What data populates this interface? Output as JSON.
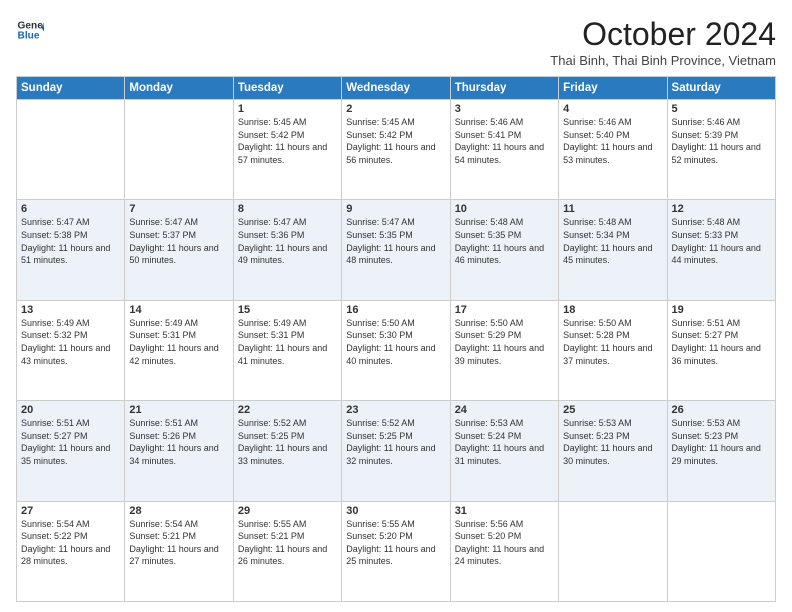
{
  "header": {
    "logo_line1": "General",
    "logo_line2": "Blue",
    "month_title": "October 2024",
    "location": "Thai Binh, Thai Binh Province, Vietnam"
  },
  "days_of_week": [
    "Sunday",
    "Monday",
    "Tuesday",
    "Wednesday",
    "Thursday",
    "Friday",
    "Saturday"
  ],
  "weeks": [
    [
      {
        "day": "",
        "info": ""
      },
      {
        "day": "",
        "info": ""
      },
      {
        "day": "1",
        "info": "Sunrise: 5:45 AM\nSunset: 5:42 PM\nDaylight: 11 hours and 57 minutes."
      },
      {
        "day": "2",
        "info": "Sunrise: 5:45 AM\nSunset: 5:42 PM\nDaylight: 11 hours and 56 minutes."
      },
      {
        "day": "3",
        "info": "Sunrise: 5:46 AM\nSunset: 5:41 PM\nDaylight: 11 hours and 54 minutes."
      },
      {
        "day": "4",
        "info": "Sunrise: 5:46 AM\nSunset: 5:40 PM\nDaylight: 11 hours and 53 minutes."
      },
      {
        "day": "5",
        "info": "Sunrise: 5:46 AM\nSunset: 5:39 PM\nDaylight: 11 hours and 52 minutes."
      }
    ],
    [
      {
        "day": "6",
        "info": "Sunrise: 5:47 AM\nSunset: 5:38 PM\nDaylight: 11 hours and 51 minutes."
      },
      {
        "day": "7",
        "info": "Sunrise: 5:47 AM\nSunset: 5:37 PM\nDaylight: 11 hours and 50 minutes."
      },
      {
        "day": "8",
        "info": "Sunrise: 5:47 AM\nSunset: 5:36 PM\nDaylight: 11 hours and 49 minutes."
      },
      {
        "day": "9",
        "info": "Sunrise: 5:47 AM\nSunset: 5:35 PM\nDaylight: 11 hours and 48 minutes."
      },
      {
        "day": "10",
        "info": "Sunrise: 5:48 AM\nSunset: 5:35 PM\nDaylight: 11 hours and 46 minutes."
      },
      {
        "day": "11",
        "info": "Sunrise: 5:48 AM\nSunset: 5:34 PM\nDaylight: 11 hours and 45 minutes."
      },
      {
        "day": "12",
        "info": "Sunrise: 5:48 AM\nSunset: 5:33 PM\nDaylight: 11 hours and 44 minutes."
      }
    ],
    [
      {
        "day": "13",
        "info": "Sunrise: 5:49 AM\nSunset: 5:32 PM\nDaylight: 11 hours and 43 minutes."
      },
      {
        "day": "14",
        "info": "Sunrise: 5:49 AM\nSunset: 5:31 PM\nDaylight: 11 hours and 42 minutes."
      },
      {
        "day": "15",
        "info": "Sunrise: 5:49 AM\nSunset: 5:31 PM\nDaylight: 11 hours and 41 minutes."
      },
      {
        "day": "16",
        "info": "Sunrise: 5:50 AM\nSunset: 5:30 PM\nDaylight: 11 hours and 40 minutes."
      },
      {
        "day": "17",
        "info": "Sunrise: 5:50 AM\nSunset: 5:29 PM\nDaylight: 11 hours and 39 minutes."
      },
      {
        "day": "18",
        "info": "Sunrise: 5:50 AM\nSunset: 5:28 PM\nDaylight: 11 hours and 37 minutes."
      },
      {
        "day": "19",
        "info": "Sunrise: 5:51 AM\nSunset: 5:27 PM\nDaylight: 11 hours and 36 minutes."
      }
    ],
    [
      {
        "day": "20",
        "info": "Sunrise: 5:51 AM\nSunset: 5:27 PM\nDaylight: 11 hours and 35 minutes."
      },
      {
        "day": "21",
        "info": "Sunrise: 5:51 AM\nSunset: 5:26 PM\nDaylight: 11 hours and 34 minutes."
      },
      {
        "day": "22",
        "info": "Sunrise: 5:52 AM\nSunset: 5:25 PM\nDaylight: 11 hours and 33 minutes."
      },
      {
        "day": "23",
        "info": "Sunrise: 5:52 AM\nSunset: 5:25 PM\nDaylight: 11 hours and 32 minutes."
      },
      {
        "day": "24",
        "info": "Sunrise: 5:53 AM\nSunset: 5:24 PM\nDaylight: 11 hours and 31 minutes."
      },
      {
        "day": "25",
        "info": "Sunrise: 5:53 AM\nSunset: 5:23 PM\nDaylight: 11 hours and 30 minutes."
      },
      {
        "day": "26",
        "info": "Sunrise: 5:53 AM\nSunset: 5:23 PM\nDaylight: 11 hours and 29 minutes."
      }
    ],
    [
      {
        "day": "27",
        "info": "Sunrise: 5:54 AM\nSunset: 5:22 PM\nDaylight: 11 hours and 28 minutes."
      },
      {
        "day": "28",
        "info": "Sunrise: 5:54 AM\nSunset: 5:21 PM\nDaylight: 11 hours and 27 minutes."
      },
      {
        "day": "29",
        "info": "Sunrise: 5:55 AM\nSunset: 5:21 PM\nDaylight: 11 hours and 26 minutes."
      },
      {
        "day": "30",
        "info": "Sunrise: 5:55 AM\nSunset: 5:20 PM\nDaylight: 11 hours and 25 minutes."
      },
      {
        "day": "31",
        "info": "Sunrise: 5:56 AM\nSunset: 5:20 PM\nDaylight: 11 hours and 24 minutes."
      },
      {
        "day": "",
        "info": ""
      },
      {
        "day": "",
        "info": ""
      }
    ]
  ]
}
